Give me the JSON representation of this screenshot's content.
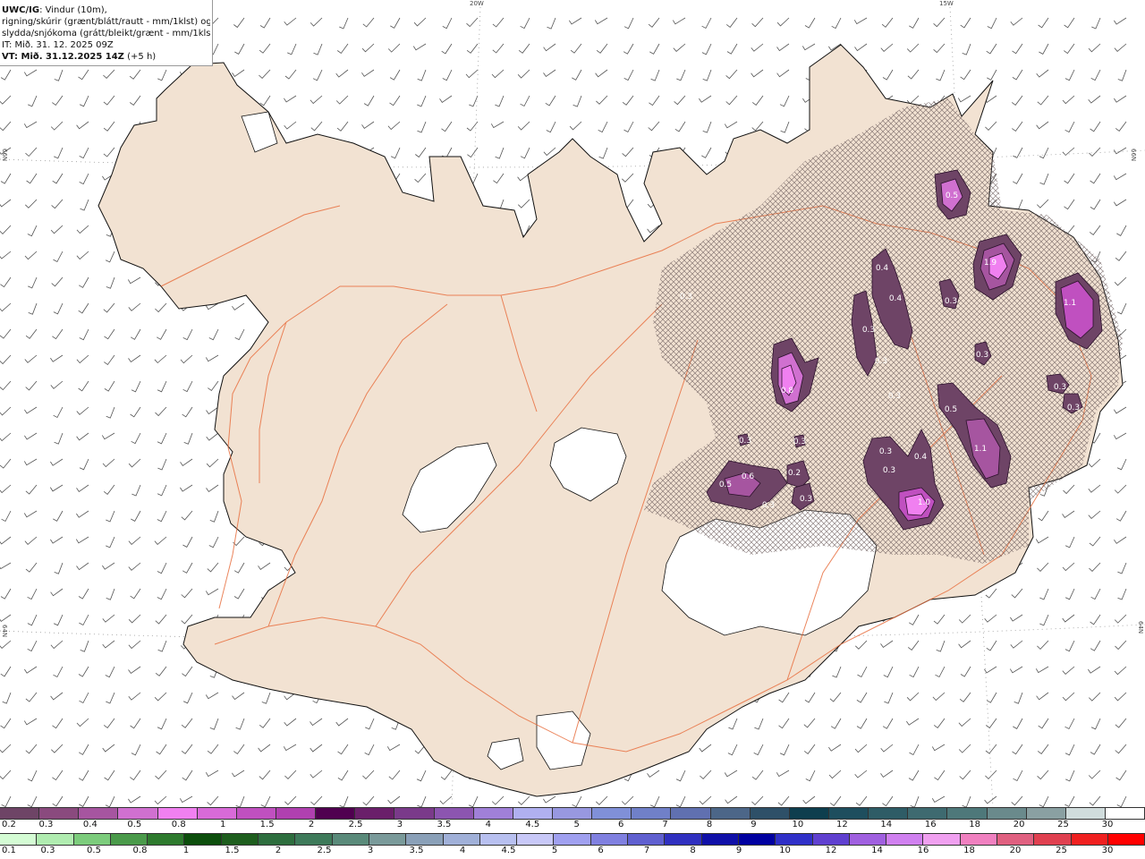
{
  "info": {
    "model": "UWC/IG",
    "line1": ": Vindur (10m),",
    "line2": "rigning/skúrir (grænt/blátt/rautt - mm/1klst) og",
    "line3": "slydda/snjókoma (grátt/bleikt/grænt - mm/1klst)",
    "issue": "IT: Mið. 31. 12. 2025 09Z",
    "valid_bold": "VT: Mið. 31.12.2025 14Z",
    "valid_extra": " (+5 h)"
  },
  "grid_labels": {
    "lon_20w": "20W",
    "lon_15w": "15W",
    "lat_66n_left": "66N",
    "lat_66n_right": "66N",
    "lat_64n_left": "64N",
    "lat_64n_right": "64N"
  },
  "precip_values": [
    {
      "id": "v1",
      "text": "0.5"
    },
    {
      "id": "v2",
      "text": "1.9"
    },
    {
      "id": "v3",
      "text": "1.1"
    },
    {
      "id": "v4",
      "text": "0.4"
    },
    {
      "id": "v5",
      "text": "0.4"
    },
    {
      "id": "v6",
      "text": "0.3"
    },
    {
      "id": "v7",
      "text": "0.3"
    },
    {
      "id": "v8",
      "text": "0.3"
    },
    {
      "id": "v9",
      "text": "0.3"
    },
    {
      "id": "v10",
      "text": "0.8"
    },
    {
      "id": "v11",
      "text": "0.3"
    },
    {
      "id": "v12",
      "text": "0.5"
    },
    {
      "id": "v13",
      "text": "1.1"
    },
    {
      "id": "v14",
      "text": "0.3"
    },
    {
      "id": "v15",
      "text": "0.3"
    },
    {
      "id": "v16",
      "text": "0.3"
    },
    {
      "id": "v17",
      "text": "0.3"
    },
    {
      "id": "v18",
      "text": "0.3"
    },
    {
      "id": "v19",
      "text": "0.4"
    },
    {
      "id": "v20",
      "text": "0.3"
    },
    {
      "id": "v21",
      "text": "1.0"
    },
    {
      "id": "v22",
      "text": "0.6"
    },
    {
      "id": "v23",
      "text": "0.5"
    },
    {
      "id": "v24",
      "text": "0.2"
    },
    {
      "id": "v25",
      "text": "0.3"
    },
    {
      "id": "v26",
      "text": "0.3"
    },
    {
      "id": "v27",
      "text": "0.3"
    }
  ],
  "legend_snow": {
    "colors": [
      "#6e4466",
      "#8a4a7e",
      "#a655a0",
      "#d070d0",
      "#f080f0",
      "#d86ad8",
      "#c050c0",
      "#b040b0",
      "#500050",
      "#6a1f6a",
      "#7a3a8a",
      "#8c55b0",
      "#a080d8",
      "#b0b0f0",
      "#9898e0",
      "#8090d8",
      "#7080c8",
      "#6070b0",
      "#4c6688",
      "#2e5068",
      "#0e3e4e",
      "#1e4e5e",
      "#2e5c66",
      "#3e6a70",
      "#4e787a",
      "#6a8a8c",
      "#8aa0a2",
      "#d0dcdc",
      "#ffffff"
    ],
    "labels": [
      "0.2",
      "0.3",
      "0.4",
      "0.5",
      "0.8",
      "1",
      "1.5",
      "2",
      "2.5",
      "3",
      "3.5",
      "4",
      "4.5",
      "5",
      "6",
      "7",
      "8",
      "9",
      "10",
      "12",
      "14",
      "16",
      "18",
      "20",
      "25",
      "30"
    ]
  },
  "legend_rain": {
    "colors": [
      "#d4fcd4",
      "#b0ecb0",
      "#7ccc7c",
      "#4a9a4a",
      "#2e7a2e",
      "#0c4e0c",
      "#1e5e1e",
      "#2e6e3e",
      "#3e7a5a",
      "#5a8a7a",
      "#7a9a9a",
      "#8aa0b8",
      "#a0b0d8",
      "#b8c0f0",
      "#c8c8f8",
      "#a0a0f0",
      "#8080e0",
      "#6060d0",
      "#3030c0",
      "#1010a8",
      "#0000a0",
      "#3030c8",
      "#6040d0",
      "#a060e0",
      "#d080f0",
      "#f0a0f0",
      "#f080c0",
      "#e06080",
      "#e04050",
      "#f02020",
      "#ff0000"
    ],
    "labels": [
      "0.1",
      "0.3",
      "0.5",
      "0.8",
      "1",
      "1.5",
      "2",
      "2.5",
      "3",
      "3.5",
      "4",
      "4.5",
      "5",
      "6",
      "7",
      "8",
      "9",
      "10",
      "12",
      "14",
      "16",
      "18",
      "20",
      "25",
      "30"
    ]
  }
}
